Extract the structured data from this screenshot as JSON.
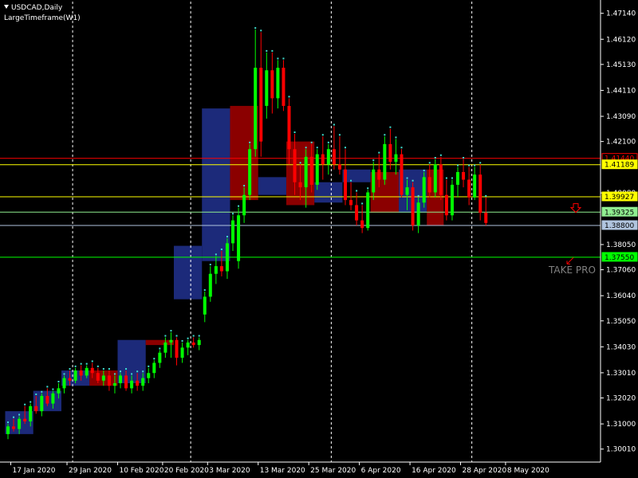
{
  "window": {
    "symbol_title": "USDCAD,Daily",
    "indicator_label": "LargeTimeframe(W1)"
  },
  "colors": {
    "background": "#000000",
    "bull_candle": "#00ff00",
    "bear_candle": "#ff0000",
    "bull_box": "#1c2a7a",
    "bear_box": "#8b0000",
    "grid_separator": "#ffffff",
    "axis": "#ffffff",
    "dot": "#40e0d0",
    "level_red": "#ff0000",
    "level_yellow": "#ffff00",
    "level_green": "#00ff00",
    "level_lightgreen": "#90ee90",
    "level_gray": "#b0c4de",
    "tp_text": "#808080"
  },
  "annotations": {
    "take_profit_text": "TAKE PRO",
    "down_arrow_icon": "down-arrow-icon",
    "small_arrow_icon": "diagonal-arrow-icon"
  },
  "chart_data": {
    "type": "candlestick",
    "title": "USDCAD,Daily",
    "timeframe_overlay": "W1",
    "ylim": [
      1.295,
      1.476
    ],
    "y_ticks": [
      "1.47140",
      "1.46120",
      "1.45130",
      "1.44110",
      "1.43090",
      "1.42100",
      "1.40080",
      "1.38050",
      "1.37060",
      "1.36040",
      "1.35050",
      "1.34030",
      "1.33010",
      "1.32020",
      "1.31000",
      "1.30010"
    ],
    "x_tick_labels": [
      "17 Jan 2020",
      "29 Jan 2020",
      "10 Feb 2020",
      "20 Feb 2020",
      "3 Mar 2020",
      "13 Mar 2020",
      "25 Mar 2020",
      "6 Apr 2020",
      "16 Apr 2020",
      "28 Apr 2020",
      "8 May 2020"
    ],
    "x_tick_index": [
      1,
      11,
      20,
      28,
      36,
      45,
      54,
      63,
      72,
      81,
      89
    ],
    "weekly_separators_index": [
      12,
      33,
      58,
      83
    ],
    "price_levels": [
      {
        "price": 1.4144,
        "label": "1.41440",
        "color": "red"
      },
      {
        "price": 1.41189,
        "label": "1.41189",
        "color": "yellow"
      },
      {
        "price": 1.39927,
        "label": "1.39927",
        "color": "yellow"
      },
      {
        "price": 1.39325,
        "label": "1.39325",
        "color": "lightgreen"
      },
      {
        "price": 1.388,
        "label": "1.38800",
        "color": "gray"
      },
      {
        "price": 1.3755,
        "label": "1.37550",
        "color": "green"
      }
    ],
    "weekly_boxes": [
      {
        "start": 0,
        "end": 5,
        "open": 1.306,
        "close": 1.315,
        "dir": "bull"
      },
      {
        "start": 5,
        "end": 10,
        "open": 1.315,
        "close": 1.323,
        "dir": "bull"
      },
      {
        "start": 10,
        "end": 15,
        "open": 1.325,
        "close": 1.331,
        "dir": "bull"
      },
      {
        "start": 15,
        "end": 20,
        "open": 1.331,
        "close": 1.325,
        "dir": "bear"
      },
      {
        "start": 20,
        "end": 25,
        "open": 1.326,
        "close": 1.343,
        "dir": "bull"
      },
      {
        "start": 25,
        "end": 30,
        "open": 1.343,
        "close": 1.341,
        "dir": "bear"
      },
      {
        "start": 30,
        "end": 35,
        "open": 1.359,
        "close": 1.38,
        "dir": "bull"
      },
      {
        "start": 35,
        "end": 40,
        "open": 1.374,
        "close": 1.434,
        "dir": "bull"
      },
      {
        "start": 40,
        "end": 45,
        "open": 1.435,
        "close": 1.398,
        "dir": "bear"
      },
      {
        "start": 45,
        "end": 50,
        "open": 1.4,
        "close": 1.407,
        "dir": "bull"
      },
      {
        "start": 50,
        "end": 55,
        "open": 1.421,
        "close": 1.396,
        "dir": "bear"
      },
      {
        "start": 55,
        "end": 60,
        "open": 1.397,
        "close": 1.405,
        "dir": "bull"
      },
      {
        "start": 60,
        "end": 65,
        "open": 1.405,
        "close": 1.41,
        "dir": "bull"
      },
      {
        "start": 65,
        "end": 70,
        "open": 1.409,
        "close": 1.393,
        "dir": "bear"
      },
      {
        "start": 70,
        "end": 75,
        "open": 1.393,
        "close": 1.41,
        "dir": "bull"
      },
      {
        "start": 75,
        "end": 78,
        "open": 1.41,
        "close": 1.388,
        "dir": "bear"
      }
    ],
    "candles": [
      {
        "o": 1.306,
        "h": 1.31,
        "l": 1.304,
        "c": 1.309
      },
      {
        "o": 1.309,
        "h": 1.312,
        "l": 1.307,
        "c": 1.308
      },
      {
        "o": 1.308,
        "h": 1.313,
        "l": 1.306,
        "c": 1.312
      },
      {
        "o": 1.312,
        "h": 1.317,
        "l": 1.31,
        "c": 1.311
      },
      {
        "o": 1.311,
        "h": 1.318,
        "l": 1.309,
        "c": 1.317
      },
      {
        "o": 1.317,
        "h": 1.321,
        "l": 1.314,
        "c": 1.315
      },
      {
        "o": 1.315,
        "h": 1.322,
        "l": 1.313,
        "c": 1.321
      },
      {
        "o": 1.321,
        "h": 1.324,
        "l": 1.317,
        "c": 1.318
      },
      {
        "o": 1.318,
        "h": 1.323,
        "l": 1.316,
        "c": 1.322
      },
      {
        "o": 1.322,
        "h": 1.326,
        "l": 1.32,
        "c": 1.324
      },
      {
        "o": 1.324,
        "h": 1.329,
        "l": 1.322,
        "c": 1.328
      },
      {
        "o": 1.328,
        "h": 1.331,
        "l": 1.325,
        "c": 1.327
      },
      {
        "o": 1.327,
        "h": 1.332,
        "l": 1.326,
        "c": 1.331
      },
      {
        "o": 1.331,
        "h": 1.333,
        "l": 1.327,
        "c": 1.329
      },
      {
        "o": 1.329,
        "h": 1.333,
        "l": 1.328,
        "c": 1.332
      },
      {
        "o": 1.332,
        "h": 1.334,
        "l": 1.328,
        "c": 1.33
      },
      {
        "o": 1.33,
        "h": 1.332,
        "l": 1.326,
        "c": 1.327
      },
      {
        "o": 1.327,
        "h": 1.331,
        "l": 1.325,
        "c": 1.329
      },
      {
        "o": 1.329,
        "h": 1.331,
        "l": 1.323,
        "c": 1.325
      },
      {
        "o": 1.325,
        "h": 1.329,
        "l": 1.322,
        "c": 1.326
      },
      {
        "o": 1.326,
        "h": 1.33,
        "l": 1.324,
        "c": 1.329
      },
      {
        "o": 1.329,
        "h": 1.331,
        "l": 1.323,
        "c": 1.324
      },
      {
        "o": 1.324,
        "h": 1.329,
        "l": 1.322,
        "c": 1.327
      },
      {
        "o": 1.327,
        "h": 1.33,
        "l": 1.323,
        "c": 1.325
      },
      {
        "o": 1.325,
        "h": 1.33,
        "l": 1.323,
        "c": 1.328
      },
      {
        "o": 1.328,
        "h": 1.332,
        "l": 1.326,
        "c": 1.33
      },
      {
        "o": 1.33,
        "h": 1.335,
        "l": 1.328,
        "c": 1.334
      },
      {
        "o": 1.334,
        "h": 1.339,
        "l": 1.332,
        "c": 1.338
      },
      {
        "o": 1.338,
        "h": 1.344,
        "l": 1.336,
        "c": 1.342
      },
      {
        "o": 1.342,
        "h": 1.346,
        "l": 1.336,
        "c": 1.343
      },
      {
        "o": 1.343,
        "h": 1.344,
        "l": 1.333,
        "c": 1.336
      },
      {
        "o": 1.336,
        "h": 1.342,
        "l": 1.334,
        "c": 1.34
      },
      {
        "o": 1.34,
        "h": 1.343,
        "l": 1.337,
        "c": 1.342
      },
      {
        "o": 1.342,
        "h": 1.344,
        "l": 1.34,
        "c": 1.341
      },
      {
        "o": 1.341,
        "h": 1.344,
        "l": 1.339,
        "c": 1.343
      },
      {
        "o": 1.353,
        "h": 1.362,
        "l": 1.35,
        "c": 1.36
      },
      {
        "o": 1.36,
        "h": 1.372,
        "l": 1.358,
        "c": 1.369
      },
      {
        "o": 1.369,
        "h": 1.376,
        "l": 1.365,
        "c": 1.372
      },
      {
        "o": 1.372,
        "h": 1.378,
        "l": 1.368,
        "c": 1.37
      },
      {
        "o": 1.37,
        "h": 1.383,
        "l": 1.367,
        "c": 1.381
      },
      {
        "o": 1.381,
        "h": 1.392,
        "l": 1.378,
        "c": 1.39
      },
      {
        "o": 1.374,
        "h": 1.395,
        "l": 1.371,
        "c": 1.392
      },
      {
        "o": 1.392,
        "h": 1.403,
        "l": 1.389,
        "c": 1.4
      },
      {
        "o": 1.4,
        "h": 1.42,
        "l": 1.398,
        "c": 1.418
      },
      {
        "o": 1.418,
        "h": 1.465,
        "l": 1.415,
        "c": 1.45
      },
      {
        "o": 1.45,
        "h": 1.464,
        "l": 1.415,
        "c": 1.421
      },
      {
        "o": 1.435,
        "h": 1.456,
        "l": 1.43,
        "c": 1.449
      },
      {
        "o": 1.449,
        "h": 1.456,
        "l": 1.432,
        "c": 1.438
      },
      {
        "o": 1.438,
        "h": 1.453,
        "l": 1.434,
        "c": 1.45
      },
      {
        "o": 1.45,
        "h": 1.453,
        "l": 1.433,
        "c": 1.435
      },
      {
        "o": 1.435,
        "h": 1.438,
        "l": 1.412,
        "c": 1.418
      },
      {
        "o": 1.418,
        "h": 1.424,
        "l": 1.4,
        "c": 1.405
      },
      {
        "o": 1.405,
        "h": 1.412,
        "l": 1.398,
        "c": 1.403
      },
      {
        "o": 1.403,
        "h": 1.418,
        "l": 1.395,
        "c": 1.415
      },
      {
        "o": 1.415,
        "h": 1.42,
        "l": 1.401,
        "c": 1.404
      },
      {
        "o": 1.404,
        "h": 1.418,
        "l": 1.402,
        "c": 1.416
      },
      {
        "o": 1.416,
        "h": 1.423,
        "l": 1.406,
        "c": 1.412
      },
      {
        "o": 1.412,
        "h": 1.42,
        "l": 1.408,
        "c": 1.418
      },
      {
        "o": 1.418,
        "h": 1.427,
        "l": 1.41,
        "c": 1.412
      },
      {
        "o": 1.412,
        "h": 1.423,
        "l": 1.408,
        "c": 1.41
      },
      {
        "o": 1.41,
        "h": 1.418,
        "l": 1.396,
        "c": 1.398
      },
      {
        "o": 1.398,
        "h": 1.405,
        "l": 1.394,
        "c": 1.396
      },
      {
        "o": 1.396,
        "h": 1.401,
        "l": 1.388,
        "c": 1.39
      },
      {
        "o": 1.39,
        "h": 1.396,
        "l": 1.385,
        "c": 1.387
      },
      {
        "o": 1.387,
        "h": 1.402,
        "l": 1.386,
        "c": 1.401
      },
      {
        "o": 1.401,
        "h": 1.413,
        "l": 1.398,
        "c": 1.41
      },
      {
        "o": 1.41,
        "h": 1.416,
        "l": 1.403,
        "c": 1.406
      },
      {
        "o": 1.406,
        "h": 1.423,
        "l": 1.404,
        "c": 1.42
      },
      {
        "o": 1.42,
        "h": 1.426,
        "l": 1.41,
        "c": 1.413
      },
      {
        "o": 1.413,
        "h": 1.422,
        "l": 1.408,
        "c": 1.416
      },
      {
        "o": 1.416,
        "h": 1.418,
        "l": 1.399,
        "c": 1.4
      },
      {
        "o": 1.4,
        "h": 1.406,
        "l": 1.394,
        "c": 1.403
      },
      {
        "o": 1.403,
        "h": 1.405,
        "l": 1.386,
        "c": 1.388
      },
      {
        "o": 1.388,
        "h": 1.399,
        "l": 1.385,
        "c": 1.397
      },
      {
        "o": 1.397,
        "h": 1.409,
        "l": 1.395,
        "c": 1.407
      },
      {
        "o": 1.407,
        "h": 1.412,
        "l": 1.399,
        "c": 1.401
      },
      {
        "o": 1.401,
        "h": 1.414,
        "l": 1.399,
        "c": 1.412
      },
      {
        "o": 1.412,
        "h": 1.415,
        "l": 1.398,
        "c": 1.4
      },
      {
        "o": 1.4,
        "h": 1.406,
        "l": 1.39,
        "c": 1.392
      },
      {
        "o": 1.392,
        "h": 1.406,
        "l": 1.39,
        "c": 1.404
      },
      {
        "o": 1.404,
        "h": 1.411,
        "l": 1.399,
        "c": 1.409
      },
      {
        "o": 1.409,
        "h": 1.414,
        "l": 1.403,
        "c": 1.406
      },
      {
        "o": 1.406,
        "h": 1.411,
        "l": 1.396,
        "c": 1.399
      },
      {
        "o": 1.399,
        "h": 1.411,
        "l": 1.398,
        "c": 1.408
      },
      {
        "o": 1.408,
        "h": 1.412,
        "l": 1.39,
        "c": 1.393
      },
      {
        "o": 1.393,
        "h": 1.399,
        "l": 1.388,
        "c": 1.389
      }
    ]
  }
}
